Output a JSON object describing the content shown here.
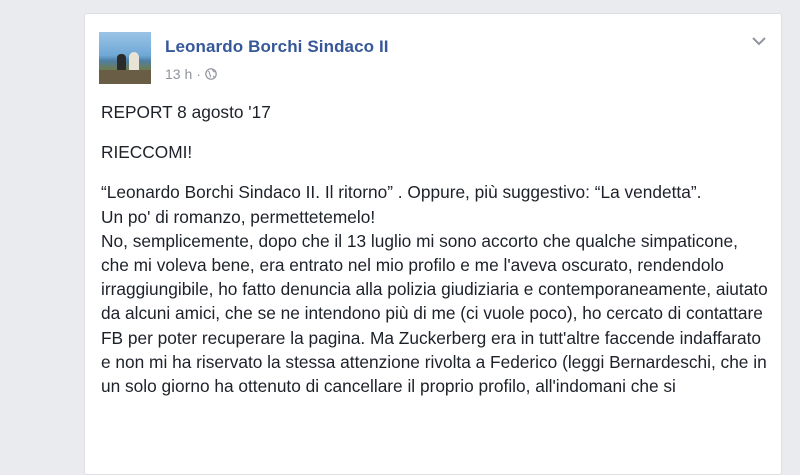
{
  "post": {
    "author": "Leonardo Borchi Sindaco II",
    "time": "13 h",
    "separator": "·",
    "privacy_icon": "globe-icon",
    "menu_icon": "chevron-down-icon",
    "avatar_alt": "profile photo"
  },
  "body": {
    "p1": "REPORT 8 agosto '17",
    "p2": "RIECCOMI!",
    "p3": "“Leonardo Borchi Sindaco II. Il ritorno” . Oppure, più suggestivo: “La vendetta”.",
    "p4": "Un po' di romanzo, permettetemelo!",
    "p5": "No, semplicemente, dopo che il 13 luglio mi sono accorto che qualche simpaticone, che mi voleva bene, era entrato nel mio profilo e me l'aveva oscurato, rendendolo irraggiungibile, ho fatto denuncia alla polizia giudiziaria e contemporaneamente, aiutato da alcuni amici, che se ne intendono più di me (ci vuole poco), ho cercato di contattare FB per poter recuperare la pagina. Ma Zuckerberg era in tutt'altre faccende indaffarato e non mi ha riservato la stessa attenzione rivolta a Federico (leggi Bernardeschi, che in un solo giorno ha ottenuto di cancellare il proprio profilo, all'indomani che si"
  },
  "colors": {
    "author_link": "#365899",
    "meta_text": "#90949c",
    "body_text": "#1d2129",
    "background": "#e9ebee"
  }
}
